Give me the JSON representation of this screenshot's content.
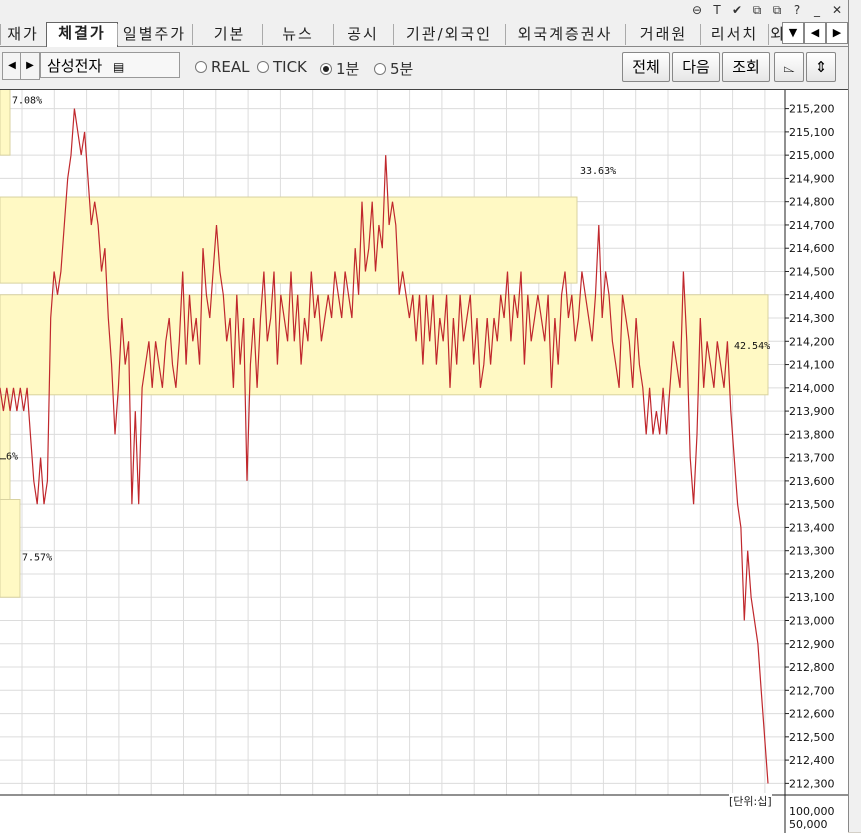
{
  "title_icons": [
    "⊖",
    "T",
    "✔",
    "⧉",
    "⧉",
    "?",
    "_",
    "✕"
  ],
  "tabs": [
    {
      "label": "재가",
      "active": false
    },
    {
      "label": "체결가",
      "active": true
    },
    {
      "label": "일별주가",
      "active": false
    },
    {
      "label": "기본",
      "active": false
    },
    {
      "label": "뉴스",
      "active": false
    },
    {
      "label": "공시",
      "active": false
    },
    {
      "label": "기관/외국인",
      "active": false
    },
    {
      "label": "외국계증권사",
      "active": false
    },
    {
      "label": "거래원",
      "active": false
    },
    {
      "label": "리서치",
      "active": false
    },
    {
      "label": "외",
      "active": false
    }
  ],
  "tab_nav": {
    "dropdown": "▼",
    "prev": "◀",
    "next": "▶"
  },
  "toolbar": {
    "stock_prev": "◀",
    "stock_next": "▶",
    "stock_name": "삼성전자",
    "radios": [
      {
        "label": "REAL",
        "selected": false
      },
      {
        "label": "TICK",
        "selected": false
      },
      {
        "label": "1분",
        "selected": true
      },
      {
        "label": "5분",
        "selected": false
      }
    ],
    "buttons": [
      "전체",
      "다음",
      "조회"
    ],
    "icon_buttons": [
      "⌳",
      "⇕"
    ]
  },
  "chart_data": {
    "type": "line",
    "yaxis_ticks": [
      215200,
      215100,
      215000,
      214900,
      214800,
      214700,
      214600,
      214500,
      214400,
      214300,
      214200,
      214100,
      214000,
      213900,
      213800,
      213700,
      213600,
      213500,
      213400,
      213300,
      213200,
      213100,
      213000,
      212900,
      212800,
      212700,
      212600,
      212500,
      212400,
      212300
    ],
    "ylim": [
      212250,
      215280
    ],
    "volume_ticks": [
      "100,000",
      "50,000"
    ],
    "unit_label": "[단위:십]",
    "grid": true,
    "price_profile": [
      {
        "low": 215000,
        "high": 215350,
        "percent": "7.08%"
      },
      {
        "low": 214450,
        "high": 214820,
        "percent": "33.63%"
      },
      {
        "low": 213970,
        "high": 214400,
        "percent": "42.54%"
      },
      {
        "low": 213450,
        "high": 213970,
        "percent": "…6%"
      },
      {
        "low": 213100,
        "high": 213520,
        "percent": "7.57%"
      }
    ],
    "series_color": "#c0282d",
    "values": [
      214000,
      213900,
      214000,
      213900,
      214000,
      213900,
      214000,
      213900,
      214000,
      213800,
      213600,
      213500,
      213700,
      213500,
      213600,
      214300,
      214500,
      214400,
      214500,
      214700,
      214900,
      215000,
      215200,
      215100,
      215000,
      215100,
      214900,
      214700,
      214800,
      214700,
      214500,
      214600,
      214300,
      214100,
      213800,
      214000,
      214300,
      214100,
      214200,
      213500,
      213900,
      213500,
      214000,
      214100,
      214200,
      214000,
      214200,
      214100,
      214000,
      214200,
      214300,
      214100,
      214000,
      214200,
      214500,
      214100,
      214400,
      214200,
      214300,
      214100,
      214600,
      214400,
      214300,
      214500,
      214700,
      214500,
      214400,
      214200,
      214300,
      214000,
      214400,
      214100,
      214300,
      213600,
      214100,
      214300,
      214000,
      214300,
      214500,
      214200,
      214300,
      214500,
      214100,
      214400,
      214300,
      214200,
      214500,
      214200,
      214400,
      214100,
      214300,
      214200,
      214500,
      214300,
      214400,
      214200,
      214300,
      214400,
      214300,
      214500,
      214400,
      214300,
      214500,
      214400,
      214300,
      214600,
      214400,
      214800,
      214500,
      214600,
      214800,
      214500,
      214700,
      214600,
      215000,
      214700,
      214800,
      214700,
      214400,
      214500,
      214400,
      214300,
      214400,
      214200,
      214400,
      214100,
      214400,
      214200,
      214400,
      214100,
      214300,
      214200,
      214400,
      214000,
      214300,
      214100,
      214400,
      214200,
      214300,
      214400,
      214100,
      214300,
      214000,
      214100,
      214300,
      214100,
      214300,
      214200,
      214400,
      214300,
      214500,
      214200,
      214400,
      214300,
      214500,
      214100,
      214400,
      214200,
      214300,
      214400,
      214300,
      214200,
      214400,
      214000,
      214300,
      214100,
      214400,
      214500,
      214300,
      214400,
      214200,
      214300,
      214500,
      214400,
      214300,
      214200,
      214400,
      214700,
      214300,
      214500,
      214400,
      214200,
      214100,
      214000,
      214400,
      214300,
      214200,
      214000,
      214300,
      214100,
      214000,
      213800,
      214000,
      213800,
      213900,
      213800,
      214000,
      213800,
      214000,
      214200,
      214100,
      214000,
      214500,
      214200,
      213700,
      213500,
      213800,
      214300,
      214000,
      214200,
      214100,
      214000,
      214200,
      214100,
      214000,
      214200,
      213900,
      213700,
      213500,
      213400,
      213000,
      213300,
      213100,
      213000,
      212900,
      212700,
      212500,
      212300
    ]
  }
}
